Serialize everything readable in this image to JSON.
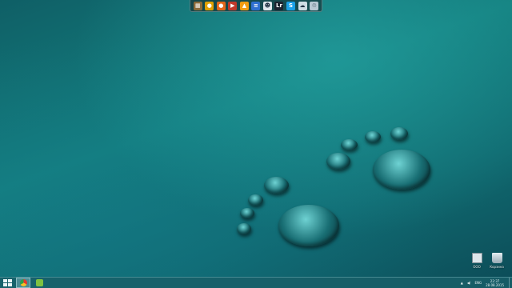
{
  "dock": {
    "icons": [
      {
        "name": "archive-icon",
        "color": "#8a6a3a",
        "glyph": "▦"
      },
      {
        "name": "chrome-icon",
        "color": "#e0a000",
        "glyph": "●"
      },
      {
        "name": "firefox-icon",
        "color": "#e2671c",
        "glyph": "●"
      },
      {
        "name": "media-player-icon",
        "color": "#c0392b",
        "glyph": "▶"
      },
      {
        "name": "vlc-icon",
        "color": "#f39c12",
        "glyph": "▲"
      },
      {
        "name": "app-icon",
        "color": "#2f6fd0",
        "glyph": "≡"
      },
      {
        "name": "alien-icon",
        "color": "#dfe8ec",
        "glyph": "☻"
      },
      {
        "name": "lightroom-icon",
        "color": "#1c2430",
        "glyph": "Lr"
      },
      {
        "name": "skype-icon",
        "color": "#1aa0e6",
        "glyph": "S"
      },
      {
        "name": "cloud-icon",
        "color": "#cfdde4",
        "glyph": "☁"
      },
      {
        "name": "recycle-bin-icon",
        "color": "#b8c8d2",
        "glyph": "♲"
      }
    ]
  },
  "desktop": {
    "icons": [
      {
        "name": "desktop-icon-ooo",
        "label": "OOO",
        "color": "#dde7ec"
      },
      {
        "name": "desktop-icon-recycle-bin",
        "label": "Корзина",
        "color": "#c3d3dc"
      }
    ]
  },
  "taskbar": {
    "tray_lang": "ENG",
    "clock_time": "22:37",
    "clock_date": "28.08.2015",
    "tray_arrow": "▲",
    "tray_volume": "◀)"
  }
}
